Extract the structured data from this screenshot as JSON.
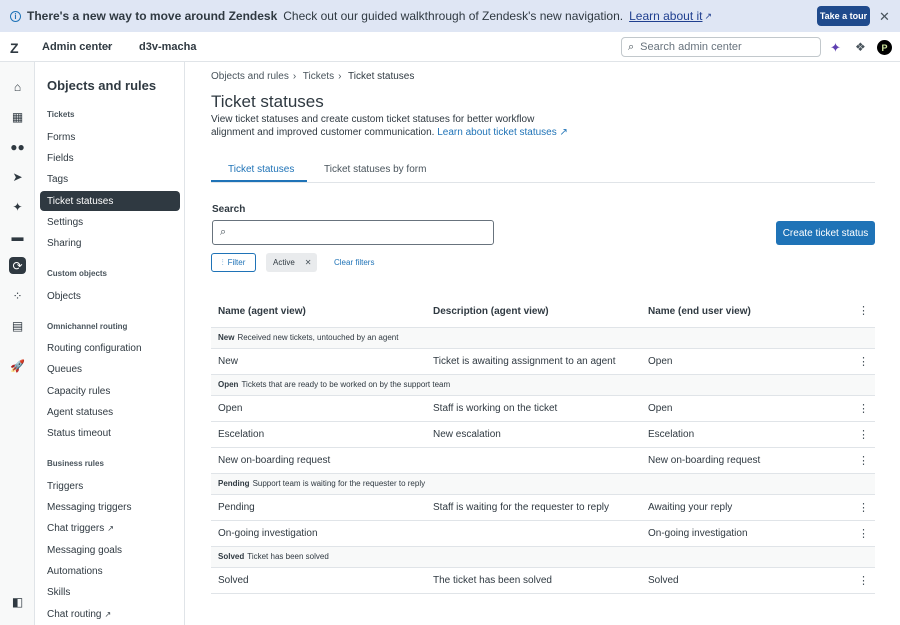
{
  "banner": {
    "title": "There's a new way to move around Zendesk",
    "message": "Check out our guided walkthrough of Zendesk's new navigation.",
    "link": "Learn about it",
    "tour_button": "Take a tour"
  },
  "topbar": {
    "logo": "Z",
    "product": "Admin center",
    "account": "d3v-macha",
    "search_placeholder": "Search admin center",
    "avatar_initial": "P"
  },
  "sidebar": {
    "title": "Objects and rules",
    "sections": [
      {
        "label": "Tickets",
        "items": [
          "Forms",
          "Fields",
          "Tags",
          "Ticket statuses",
          "Settings",
          "Sharing"
        ]
      },
      {
        "label": "Custom objects",
        "items": [
          "Objects"
        ]
      },
      {
        "label": "Omnichannel routing",
        "items": [
          "Routing configuration",
          "Queues",
          "Capacity rules",
          "Agent statuses",
          "Status timeout"
        ]
      },
      {
        "label": "Business rules",
        "items": [
          "Triggers",
          "Messaging triggers",
          "Chat triggers",
          "Messaging goals",
          "Automations",
          "Skills",
          "Chat routing"
        ]
      }
    ]
  },
  "breadcrumb": [
    "Objects and rules",
    "Tickets",
    "Ticket statuses"
  ],
  "page": {
    "title": "Ticket statuses",
    "description": "View ticket statuses and create custom ticket statuses for better workflow alignment and improved customer communication.",
    "learn_link": "Learn about ticket statuses"
  },
  "tabs": [
    "Ticket statuses",
    "Ticket statuses by form"
  ],
  "search": {
    "label": "Search",
    "placeholder": ""
  },
  "create_button": "Create ticket status",
  "filters": {
    "filter_button": "Filter",
    "chip": "Active",
    "clear": "Clear filters"
  },
  "table": {
    "columns": [
      "Name (agent view)",
      "Description (agent view)",
      "Name (end user view)"
    ],
    "groups": [
      {
        "name": "New",
        "desc": "Received new tickets, untouched by an agent",
        "rows": [
          [
            "New",
            "Ticket is awaiting assignment to an agent",
            "Open"
          ]
        ]
      },
      {
        "name": "Open",
        "desc": "Tickets that are ready to be worked on by the support team",
        "rows": [
          [
            "Open",
            "Staff is working on the ticket",
            "Open"
          ],
          [
            "Escelation",
            "New escalation",
            "Escelation"
          ],
          [
            "New on-boarding request",
            "",
            "New on-boarding request"
          ]
        ]
      },
      {
        "name": "Pending",
        "desc": "Support team is waiting for the requester to reply",
        "rows": [
          [
            "Pending",
            "Staff is waiting for the requester to reply",
            "Awaiting your reply"
          ],
          [
            "On-going investigation",
            "",
            "On-going investigation"
          ]
        ]
      },
      {
        "name": "Solved",
        "desc": "Ticket has been solved",
        "rows": [
          [
            "Solved",
            "The ticket has been solved",
            "Solved"
          ]
        ]
      }
    ]
  }
}
